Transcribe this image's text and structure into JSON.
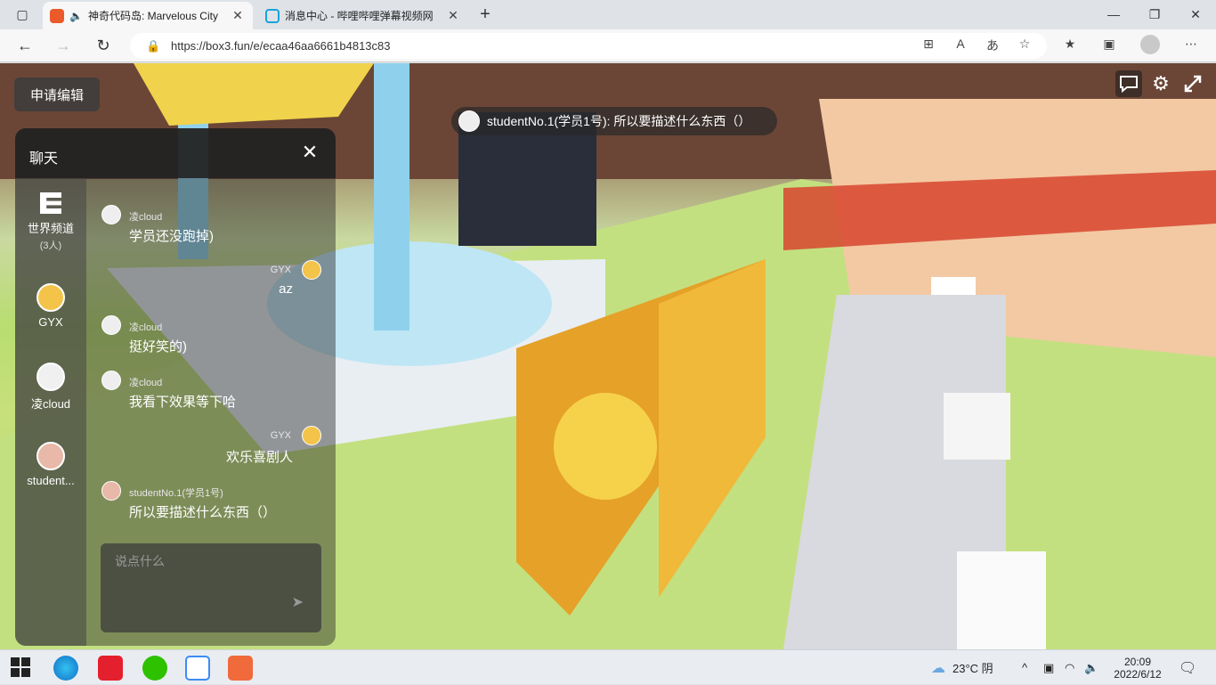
{
  "browser": {
    "tabs": [
      {
        "title": "神奇代码岛: Marvelous City",
        "active": true
      },
      {
        "title": "消息中心 - 哔哩哔哩弹幕视频网",
        "active": false
      }
    ],
    "url": "https://box3.fun/e/ecaa46aa6661b4813c83",
    "new_tab": "+"
  },
  "game": {
    "edit_button": "申请编辑",
    "bubble": "studentNo.1(学员1号): 所以要描述什么东西（）"
  },
  "chat": {
    "title": "聊天",
    "sidebar": [
      {
        "label": "世界频道",
        "sub": "(3人)"
      },
      {
        "label": "GYX"
      },
      {
        "label": "凌cloud"
      },
      {
        "label": "student..."
      }
    ],
    "messages": [
      {
        "side": "left",
        "name": "凌cloud",
        "text": "学员还没跑掉)"
      },
      {
        "side": "right",
        "name": "GYX",
        "text": "az"
      },
      {
        "side": "left",
        "name": "凌cloud",
        "text": "挺好笑的)"
      },
      {
        "side": "left",
        "name": "凌cloud",
        "text": "我看下效果等下哈"
      },
      {
        "side": "right",
        "name": "GYX",
        "text": "欢乐喜剧人"
      },
      {
        "side": "left",
        "name": "studentNo.1(学员1号)",
        "text": "所以要描述什么东西（）"
      }
    ],
    "input_placeholder": "说点什么"
  },
  "taskbar": {
    "weather": "23°C 阴",
    "time": "20:09",
    "date": "2022/6/12"
  }
}
